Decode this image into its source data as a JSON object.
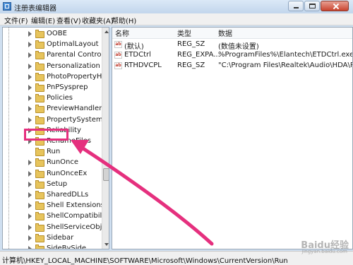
{
  "window": {
    "title": "注册表编辑器"
  },
  "menu": [
    "文件(F)",
    "编辑(E)",
    "查看(V)",
    "收藏夹(A)",
    "帮助(H)"
  ],
  "tree": {
    "items": [
      {
        "label": "OOBE"
      },
      {
        "label": "OptimalLayout"
      },
      {
        "label": "Parental Controls"
      },
      {
        "label": "Personalization"
      },
      {
        "label": "PhotoPropertyHanc"
      },
      {
        "label": "PnPSysprep"
      },
      {
        "label": "Policies"
      },
      {
        "label": "PreviewHandlers"
      },
      {
        "label": "PropertySystem"
      },
      {
        "label": "Reliability"
      },
      {
        "label": "RenameFiles"
      },
      {
        "label": "Run",
        "selected": true
      },
      {
        "label": "RunOnce"
      },
      {
        "label": "RunOnceEx"
      },
      {
        "label": "Setup"
      },
      {
        "label": "SharedDLLs"
      },
      {
        "label": "Shell Extensions"
      },
      {
        "label": "ShellCompatibility"
      },
      {
        "label": "ShellServiceObjectD"
      },
      {
        "label": "Sidebar"
      },
      {
        "label": "SideBySide"
      },
      {
        "label": "SMDEn"
      },
      {
        "label": "SMI"
      }
    ]
  },
  "list": {
    "columns": [
      "名称",
      "类型",
      "数据"
    ],
    "rows": [
      {
        "name": "(默认)",
        "type": "REG_SZ",
        "data": "(数值未设置)"
      },
      {
        "name": "ETDCtrl",
        "type": "REG_EXPA...",
        "data": "%ProgramFiles%\\Elantech\\ETDCtrl.exe"
      },
      {
        "name": "RTHDVCPL",
        "type": "REG_SZ",
        "data": "\"C:\\Program Files\\Realtek\\Audio\\HDA\\RAVCp"
      }
    ]
  },
  "status": "计算机\\HKEY_LOCAL_MACHINE\\SOFTWARE\\Microsoft\\Windows\\CurrentVersion\\Run",
  "watermark": {
    "brand": "Baidu经验",
    "sub": "jingyan.baidu.com"
  },
  "colors": {
    "annotation": "#e5307e"
  }
}
